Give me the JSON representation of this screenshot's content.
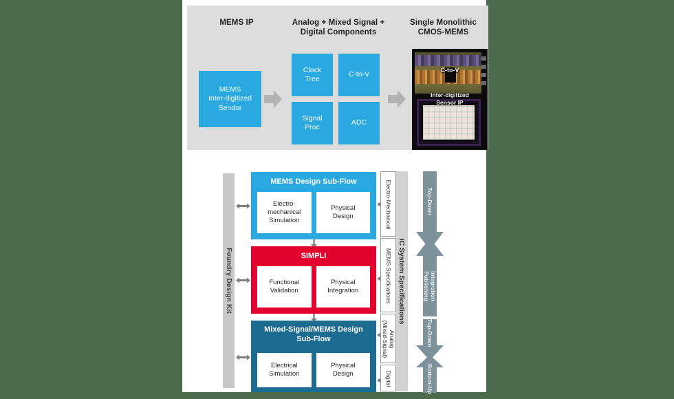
{
  "figure": {
    "background_color": "#4c6b4c",
    "page_color": "#ffffff"
  },
  "top_panel": {
    "background_color": "#dddddd",
    "columns": [
      {
        "title": "MEMS IP"
      },
      {
        "title": "Analog + Mixed Signal +\nDigital Components"
      },
      {
        "title": "Single Monolithic\nCMOS-MEMS"
      }
    ],
    "titles": {
      "mems_ip": "MEMS IP",
      "analog_line1": "Analog + Mixed Signal +",
      "analog_line2": "Digital Components",
      "single_line1": "Single Monolithic",
      "single_line2": "CMOS-MEMS"
    },
    "mems_block": {
      "line1": "MEMS",
      "line2": "Inter-digitized",
      "line3": "Sendor",
      "color": "#29a9e0"
    },
    "component_blocks": [
      {
        "line1": "Clock",
        "line2": "Tree"
      },
      {
        "line1": "C-to-V",
        "line2": ""
      },
      {
        "line1": "Signal",
        "line2": "Proc"
      },
      {
        "line1": "ADC",
        "line2": ""
      }
    ],
    "chip_photo": {
      "top_label": "C-to-V",
      "bottom_label_line1": "Inter-digitized",
      "bottom_label_line2": "Sensor IP"
    },
    "arrows": [
      {
        "name": "arrow-mems-to-components",
        "direction": "right"
      },
      {
        "name": "arrow-components-to-chip",
        "direction": "right"
      }
    ]
  },
  "flow_diagram": {
    "foundry": {
      "label": "Foundry Design Kit",
      "color": "#c8c8c8"
    },
    "blocks": [
      {
        "name": "mems-design-sub-flow",
        "title": "MEMS Design Sub-Flow",
        "color": "#29a9e0",
        "sub_boxes": [
          {
            "line1": "Electro-",
            "line2": "mechanical",
            "line3": "Simulation"
          },
          {
            "line1": "Physical",
            "line2": "Design",
            "line3": ""
          }
        ]
      },
      {
        "name": "simpli",
        "title": "SIMPLI",
        "color": "#e4032e",
        "sub_boxes": [
          {
            "line1": "Functional",
            "line2": "Validation",
            "line3": ""
          },
          {
            "line1": "Physical",
            "line2": "Integration",
            "line3": ""
          }
        ]
      },
      {
        "name": "mixed-signal-mems-design-sub-flow",
        "title": "Mixed-Signal/MEMS Design\nSub-Flow",
        "title_line1": "Mixed-Signal/MEMS Design",
        "title_line2": "Sub-Flow",
        "color": "#1c6b91",
        "sub_boxes": [
          {
            "line1": "Electrical",
            "line2": "Simulation",
            "line3": ""
          },
          {
            "line1": "Physical",
            "line2": "Design",
            "line3": ""
          }
        ]
      }
    ],
    "specifications": {
      "label": "IC System Specifications",
      "color": "#d2d2d2",
      "items": [
        {
          "label": "Electro-Mechanical",
          "line1": "Electro-Mechanical",
          "line2": ""
        },
        {
          "label": "MEMS Specifications",
          "line1": "MEMS Specifications",
          "line2": ""
        },
        {
          "label": "Analog (Mixed-Signal)",
          "line1": "Analog",
          "line2": "(Mixed-Signal)"
        },
        {
          "label": "Digital",
          "line1": "Digital",
          "line2": ""
        }
      ]
    },
    "process_arrows": [
      {
        "name": "top-down-1",
        "label": "Top-Down",
        "direction": "down",
        "color": "#7e929c"
      },
      {
        "name": "integration-publishing",
        "label_line1": "Integration",
        "label_line2": "Publishing",
        "label": "Integration Publishing",
        "direction": "up",
        "color": "#7e929c"
      },
      {
        "name": "top-down-2",
        "label": "Top-Down",
        "direction": "down",
        "color": "#7e929c"
      },
      {
        "name": "bottom-up",
        "label": "Bottom-Up",
        "direction": "up",
        "color": "#7e929c"
      }
    ]
  }
}
